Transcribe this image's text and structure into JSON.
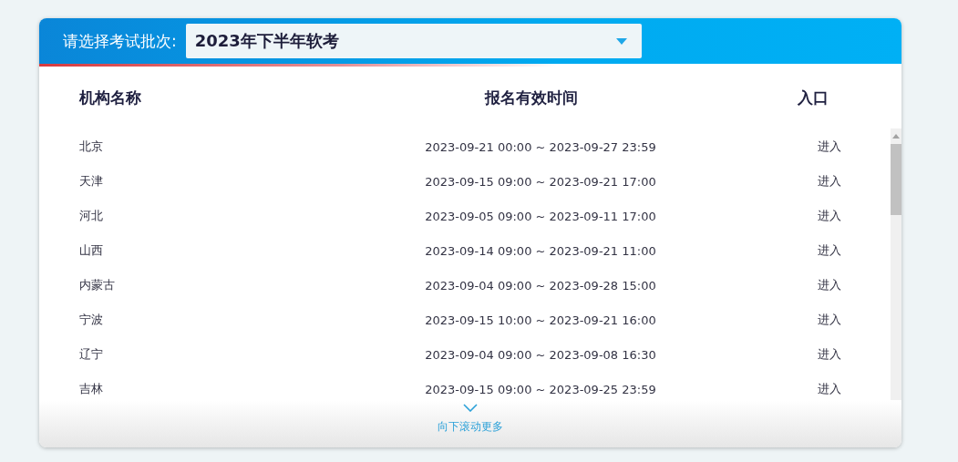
{
  "batch_select": {
    "label": "请选择考试批次:",
    "value": "2023年下半年软考"
  },
  "table": {
    "columns": [
      "机构名称",
      "报名有效时间",
      "入口"
    ],
    "rows": [
      {
        "name": "北京",
        "time": "2023-09-21 00:00 ~ 2023-09-27 23:59",
        "entry": "进入"
      },
      {
        "name": "天津",
        "time": "2023-09-15 09:00 ~ 2023-09-21 17:00",
        "entry": "进入"
      },
      {
        "name": "河北",
        "time": "2023-09-05 09:00 ~ 2023-09-11 17:00",
        "entry": "进入"
      },
      {
        "name": "山西",
        "time": "2023-09-14 09:00 ~ 2023-09-21 11:00",
        "entry": "进入"
      },
      {
        "name": "内蒙古",
        "time": "2023-09-04 09:00 ~ 2023-09-28 15:00",
        "entry": "进入"
      },
      {
        "name": "宁波",
        "time": "2023-09-15 10:00 ~ 2023-09-21 16:00",
        "entry": "进入"
      },
      {
        "name": "辽宁",
        "time": "2023-09-04 09:00 ~ 2023-09-08 16:30",
        "entry": "进入"
      },
      {
        "name": "吉林",
        "time": "2023-09-15 09:00 ~ 2023-09-25 23:59",
        "entry": "进入"
      }
    ]
  },
  "scroll_hint": "向下滚动更多"
}
